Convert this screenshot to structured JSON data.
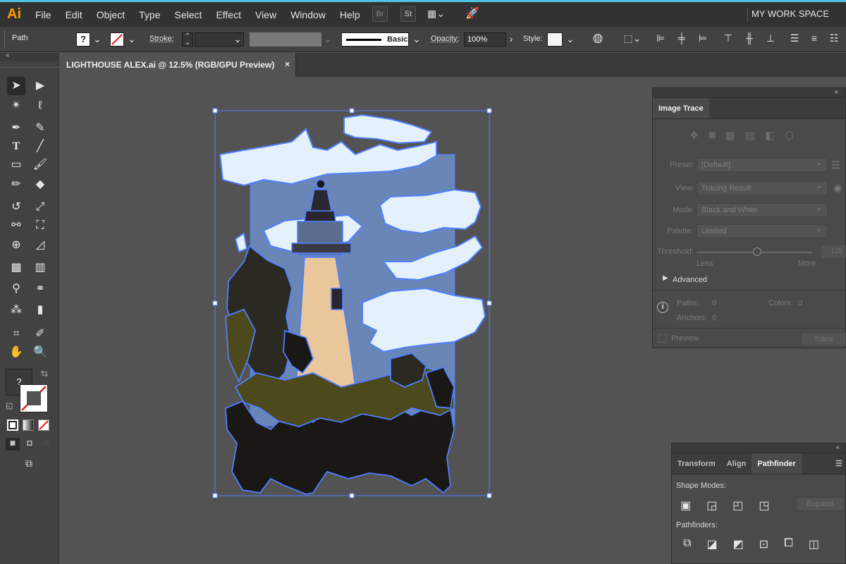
{
  "app": {
    "logo": "Ai",
    "workspace": "MY WORK SPACE"
  },
  "menu": [
    "File",
    "Edit",
    "Object",
    "Type",
    "Select",
    "Effect",
    "View",
    "Window",
    "Help"
  ],
  "menubar_buttons": {
    "bridge": "Br",
    "stock": "St"
  },
  "control": {
    "object_type": "Path",
    "fill_value": "?",
    "stroke_label": "Stroke:",
    "brush_label": "Basic",
    "opacity_label": "Opacity:",
    "opacity_value": "100%",
    "style_label": "Style:"
  },
  "document_tab": {
    "title": "LIGHTHOUSE ALEX.ai @ 12.5% (RGB/GPU Preview)",
    "close": "×"
  },
  "tools": {
    "fill_unknown": "?"
  },
  "image_trace": {
    "tab": "Image Trace",
    "preset_label": "Preset:",
    "preset_value": "[Default]",
    "view_label": "View:",
    "view_value": "Tracing Result",
    "mode_label": "Mode:",
    "mode_value": "Black and White",
    "palette_label": "Palette:",
    "palette_value": "Limited",
    "threshold_label": "Threshold:",
    "threshold_value": "128",
    "less": "Less",
    "more": "More",
    "advanced": "Advanced",
    "paths_label": "Paths:",
    "paths_value": "0",
    "colors_label": "Colors:",
    "colors_value": "0",
    "anchors_label": "Anchors:",
    "anchors_value": "0",
    "preview": "Preview",
    "trace": "Trace"
  },
  "pathfinder_panel": {
    "tabs": [
      "Transform",
      "Align",
      "Pathfinder"
    ],
    "shape_modes": "Shape Modes:",
    "expand": "Expand",
    "pathfinders": "Pathfinders:"
  },
  "colors": {
    "accent": "#4ec3e0",
    "selection": "#4f7fff",
    "sky": "#6a86b6",
    "cloud": "#e4f1fb",
    "tower": "#eac79a",
    "dark": "#1a1814",
    "olive": "#4c4a1c"
  }
}
